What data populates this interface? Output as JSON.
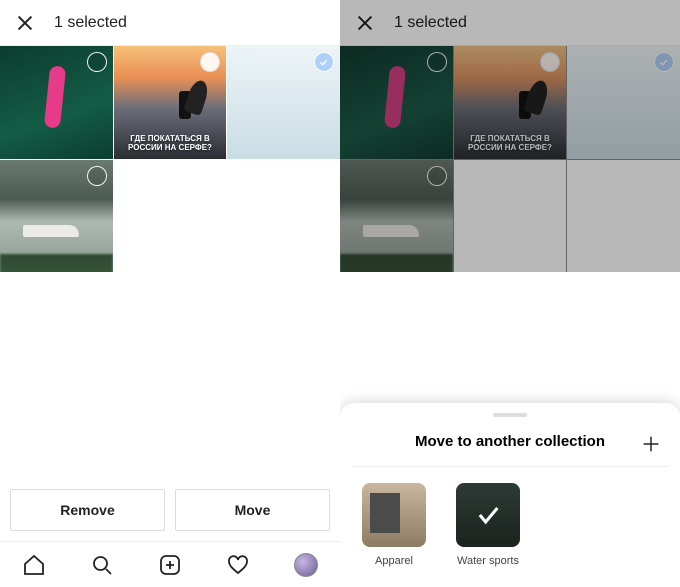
{
  "left": {
    "headerTitle": "1 selected",
    "buttons": {
      "remove": "Remove",
      "move": "Move"
    },
    "thumbs": [
      {
        "name": "thumb-kayak",
        "caption": null
      },
      {
        "name": "thumb-surfer",
        "caption": "ГДЕ ПОКАТАТЬСЯ\nВ РОССИИ НА СЕРФЕ?"
      },
      {
        "name": "thumb-water",
        "caption": null
      },
      {
        "name": "thumb-boat",
        "caption": null
      }
    ]
  },
  "right": {
    "headerTitle": "1 selected",
    "sheet": {
      "title": "Move to another collection",
      "collections": [
        {
          "label": "Apparel",
          "selected": false
        },
        {
          "label": "Water sports",
          "selected": true
        }
      ]
    }
  }
}
